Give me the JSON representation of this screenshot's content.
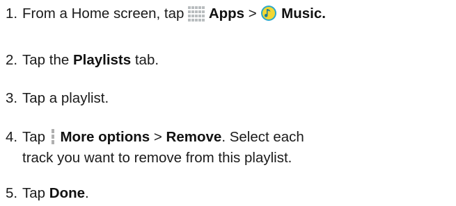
{
  "steps": [
    {
      "number": "1.",
      "text_before": "From a Home screen, tap",
      "apps_label": "Apps",
      "separator": ">",
      "music_label": "Music."
    },
    {
      "number": "2.",
      "text_before": "Tap the",
      "bold": "Playlists",
      "text_after": "tab."
    },
    {
      "number": "3.",
      "text": "Tap a playlist."
    },
    {
      "number": "4.",
      "text_before": "Tap",
      "more_options_label": "More options",
      "separator": ">",
      "remove_label": "Remove",
      "text_after": ". Select each",
      "line2": "track you want to remove from this playlist."
    },
    {
      "number": "5.",
      "text_before": "Tap",
      "bold": "Done",
      "text_after": "."
    }
  ],
  "icons": {
    "apps": "apps-grid-icon",
    "music": "music-note-icon",
    "more_options": "more-options-icon"
  },
  "colors": {
    "apps_icon": "#b9bdbf",
    "music_icon_ring": "#2aa7c9",
    "music_icon_fill": "#f2d733",
    "more_icon": "#b0b0b0"
  }
}
